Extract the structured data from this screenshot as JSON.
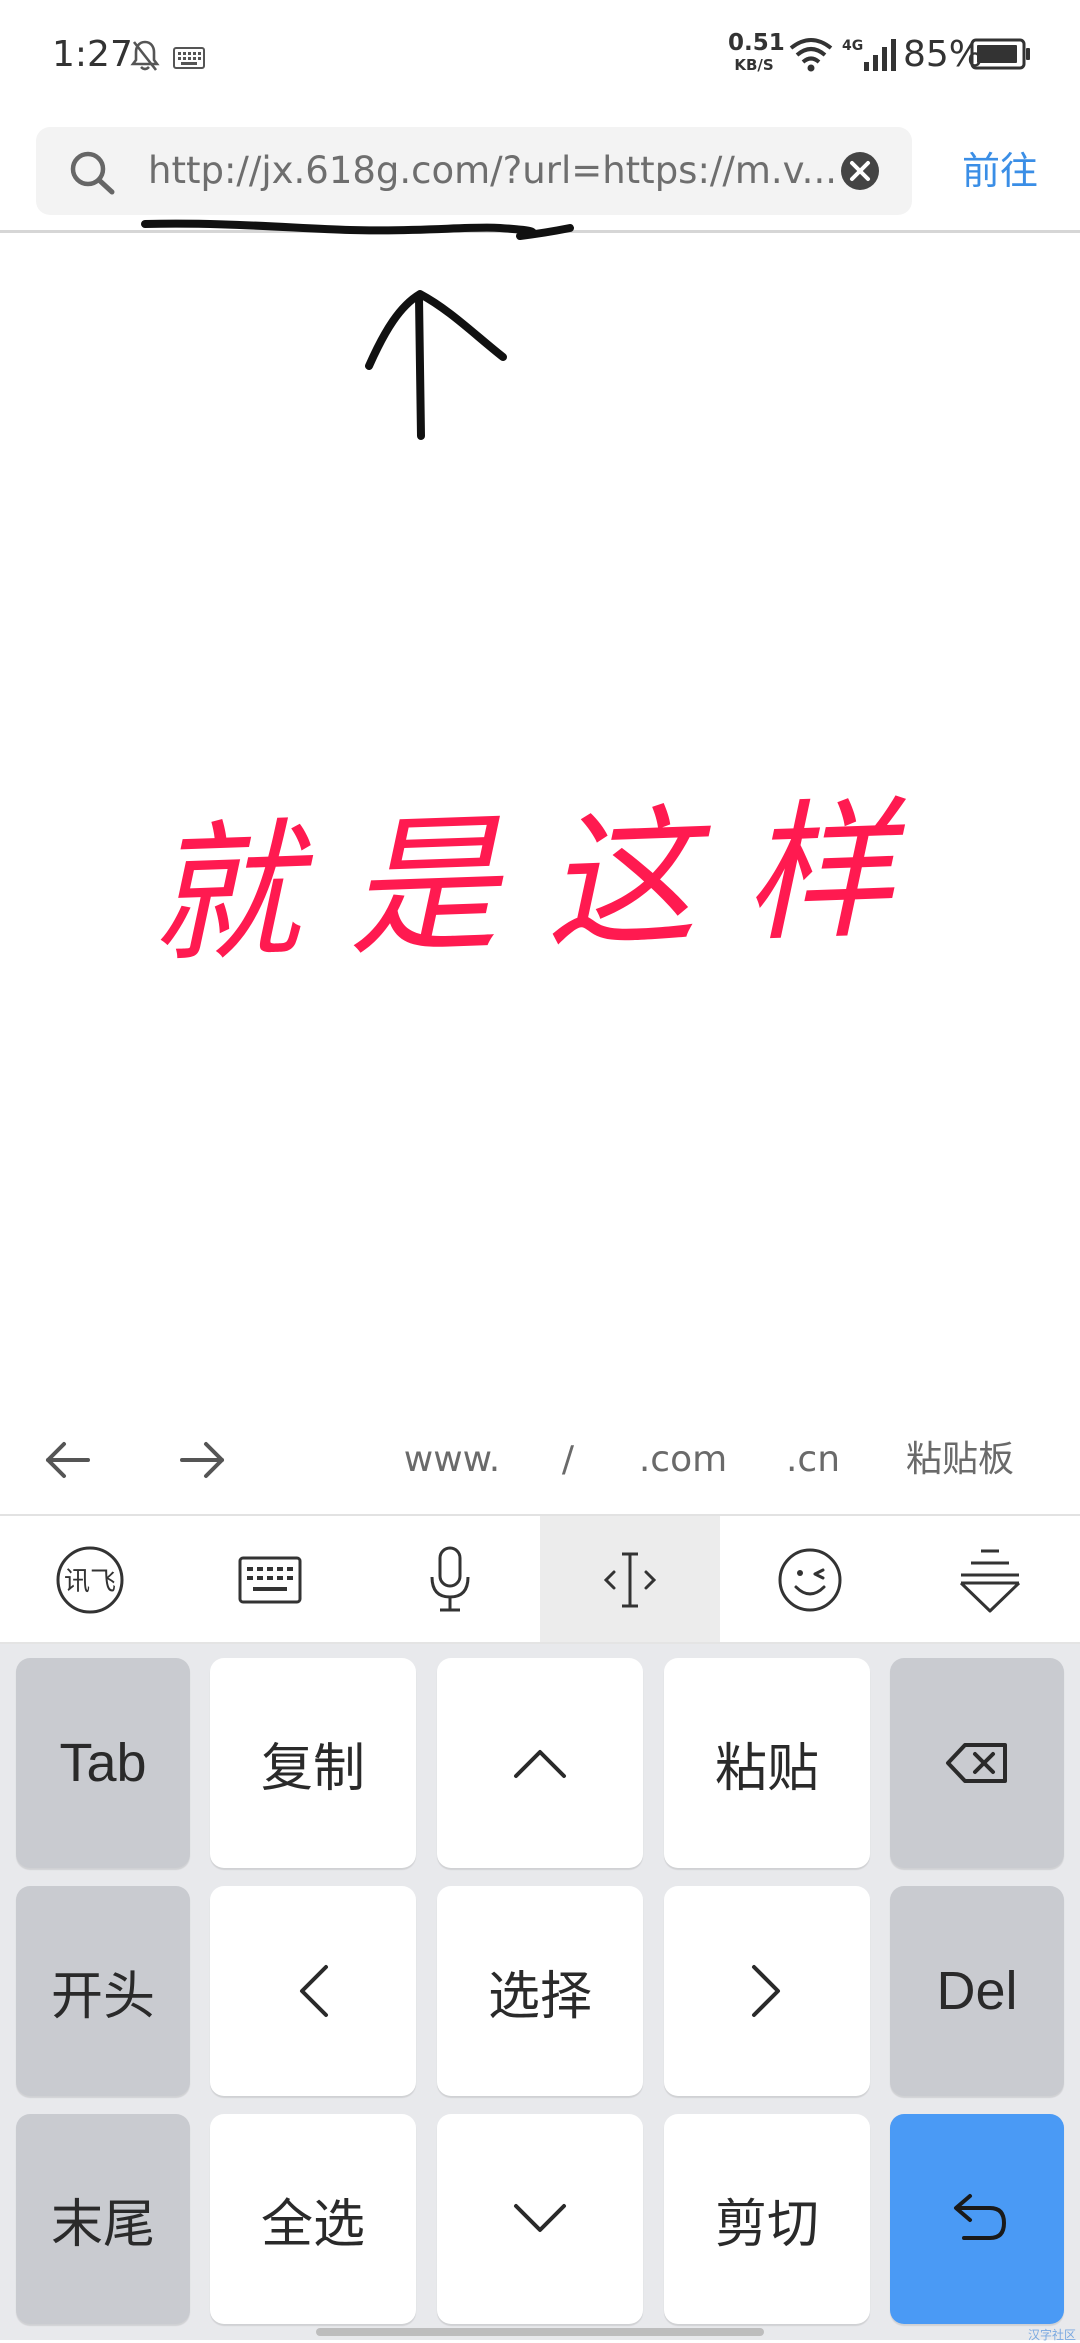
{
  "status_bar": {
    "time": "1:27",
    "net_speed_value": "0.51",
    "net_speed_unit": "KB/S",
    "network_type": "4G",
    "battery_percent": "85%",
    "icons": [
      "bell-muted-icon",
      "keyboard-icon",
      "wifi-icon",
      "signal-icon",
      "battery-icon"
    ]
  },
  "url_bar": {
    "url": "http://jx.618g.com/?url=https://m.v...",
    "go_label": "前往",
    "accent_color": "#3a8ee6"
  },
  "annotation": {
    "handwritten_text": "就是这样",
    "color": "#ff1a50"
  },
  "suggestion_bar": {
    "items": [
      "www.",
      "/",
      ".com",
      ".cn",
      "粘贴板"
    ]
  },
  "keyboard_toolbar": {
    "ime_logo_text": "讯飞",
    "items": [
      "ime-logo-icon",
      "keyboard-icon",
      "microphone-icon",
      "text-cursor-icon",
      "emoji-icon",
      "collapse-keyboard-icon"
    ]
  },
  "keyboard": {
    "keys": {
      "tab": "Tab",
      "copy": "复制",
      "paste": "粘贴",
      "line_start": "开头",
      "select": "选择",
      "del": "Del",
      "line_end": "末尾",
      "select_all": "全选",
      "cut": "剪切"
    },
    "enter_color": "#4a9af5"
  },
  "watermark": "汉字社区"
}
